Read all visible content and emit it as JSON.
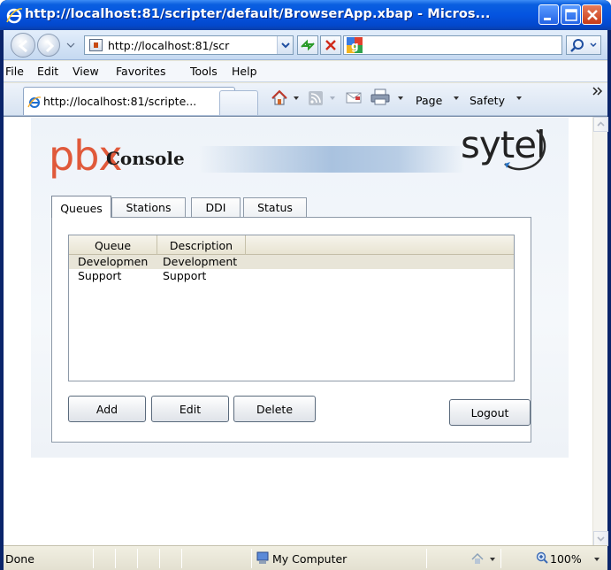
{
  "window": {
    "title": "http://localhost:81/scripter/default/BrowserApp.xbap - Micros..."
  },
  "addressbar": {
    "url": "http://localhost:81/scr",
    "search_placeholder": ""
  },
  "menu": {
    "items": [
      {
        "label": "File"
      },
      {
        "label": "Edit"
      },
      {
        "label": "View"
      },
      {
        "label": "Favorites"
      },
      {
        "label": "Tools"
      },
      {
        "label": "Help"
      }
    ]
  },
  "tab": {
    "label": "http://localhost:81/scripte..."
  },
  "commandbar": {
    "page_label": "Page",
    "safety_label": "Safety"
  },
  "app": {
    "logo_left": "pbx",
    "logo_title": "Console",
    "logo_right": "sytel",
    "tabs": [
      {
        "label": "Queues"
      },
      {
        "label": "Stations"
      },
      {
        "label": "DDI"
      },
      {
        "label": "Status"
      }
    ],
    "grid": {
      "columns": [
        "Queue",
        "Description"
      ],
      "rows": [
        {
          "queue": "Developmen",
          "description": "Development"
        },
        {
          "queue": "Support",
          "description": "Support"
        }
      ]
    },
    "buttons": {
      "add": "Add",
      "edit": "Edit",
      "delete": "Delete",
      "logout": "Logout"
    }
  },
  "statusbar": {
    "status": "Done",
    "zone": "My Computer",
    "zoom": "100%"
  },
  "colors": {
    "title_blue": "#0454e0",
    "pbx_orange": "#e0593a",
    "close_red": "#c73b17"
  }
}
